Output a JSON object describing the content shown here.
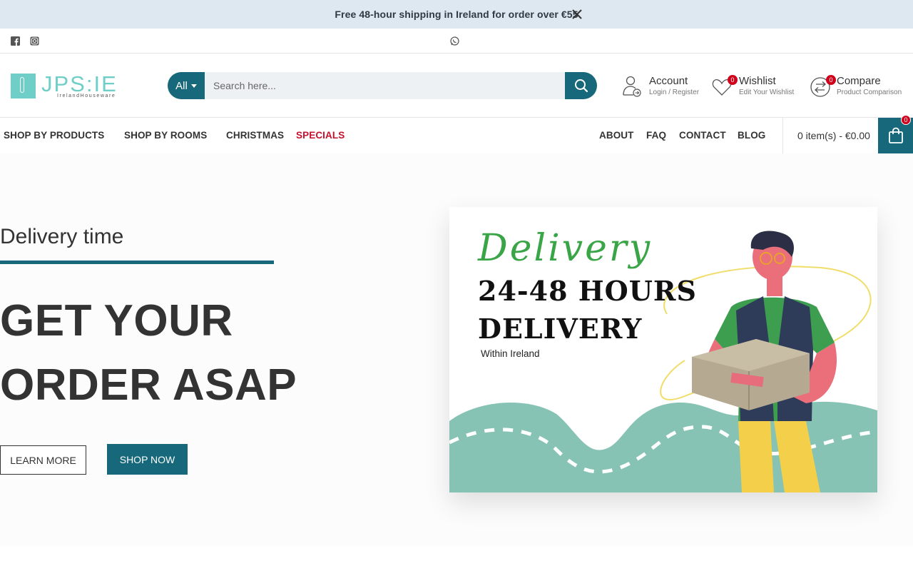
{
  "announcement": {
    "text": "Free 48-hour shipping in Ireland for order over €55",
    "close_icon": "close-icon"
  },
  "social": {
    "icons": [
      "facebook-icon",
      "instagram-icon",
      "whatsapp-icon"
    ]
  },
  "header": {
    "logo_text": "JPS:IE",
    "logo_subtext": "IrelandHouseware",
    "search": {
      "category_label": "All",
      "placeholder": "Search here..."
    },
    "account": {
      "title": "Account",
      "subtitle": "Login / Register"
    },
    "wishlist": {
      "title": "Wishlist",
      "subtitle": "Edit Your Wishlist",
      "count": "0"
    },
    "compare": {
      "title": "Compare",
      "subtitle": "Product Comparison",
      "count": "0"
    }
  },
  "nav": {
    "left": [
      {
        "label": "SHOP BY PRODUCTS"
      },
      {
        "label": "SHOP BY ROOMS"
      },
      {
        "label": "CHRISTMAS"
      },
      {
        "label": "SPECIALS"
      }
    ],
    "right": [
      {
        "label": "ABOUT"
      },
      {
        "label": "FAQ"
      },
      {
        "label": "CONTACT"
      },
      {
        "label": "BLOG"
      }
    ],
    "cart_text": "0 item(s) - €0.00",
    "cart_count": "0"
  },
  "hero": {
    "kicker": "Delivery time",
    "title_line1": "GET YOUR",
    "title_line2": "ORDER ASAP",
    "learn_more": "LEARN MORE",
    "shop_now": "SHOP NOW",
    "banner": {
      "script_title": "Delivery",
      "line1": "24-48 HOURS",
      "line2": "DELIVERY",
      "subtitle": "Within Ireland"
    }
  },
  "colors": {
    "brand": "#17687b",
    "announce_bg": "#dde8f1",
    "special": "#c8102e",
    "badge": "#d0021b",
    "logo": "#6fcfc8"
  }
}
